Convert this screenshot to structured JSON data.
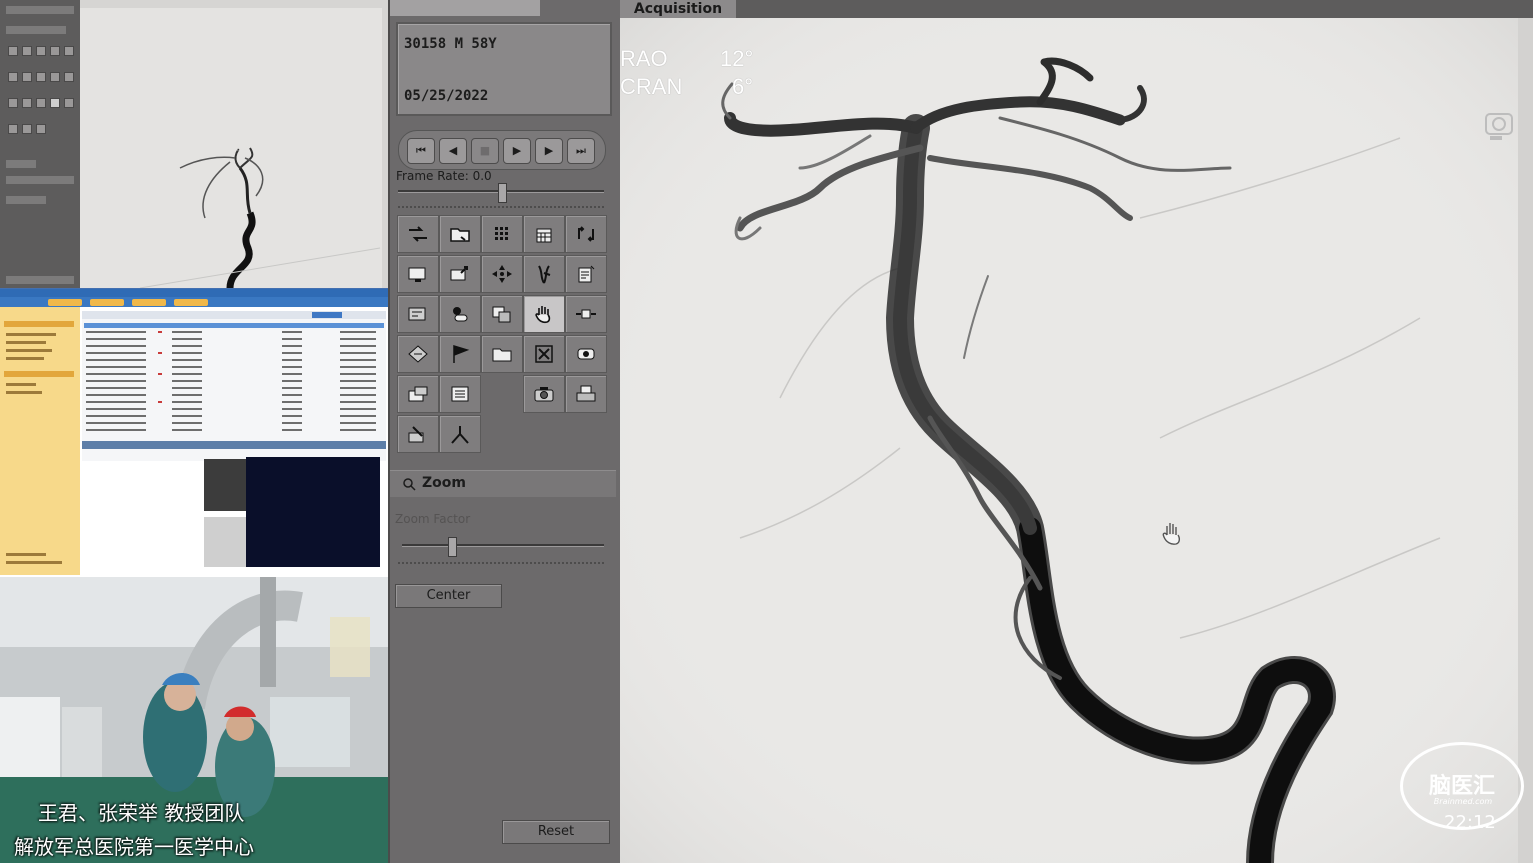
{
  "patient": {
    "id_line": "30158 M 58Y",
    "date": "05/25/2022"
  },
  "playback": {
    "frame_rate_label": "Frame Rate: 0.0",
    "buttons": [
      "first-frame",
      "step-back",
      "stop",
      "play",
      "step-forward",
      "last-frame"
    ]
  },
  "zoom": {
    "title": "Zoom",
    "factor_label": "Zoom Factor",
    "center_label": "Center",
    "reset_label": "Reset"
  },
  "viewer": {
    "tab_label": "Acquisition",
    "angle1_label": "RAO",
    "angle1_value": "12°",
    "angle2_label": "CRAN",
    "angle2_value": "6°"
  },
  "video": {
    "caption_line1": "王君、张荣举 教授团队",
    "caption_line2": "解放军总医院第一医学中心"
  },
  "watermark": {
    "logo_text": "脑医汇",
    "logo_sub": "Brainmed.com",
    "timestamp": "22:12"
  },
  "tools": [
    "loop-icon",
    "folder-icon",
    "grid-icon",
    "calendar-icon",
    "swap-icon",
    "monitor-icon",
    "export-icon",
    "move-icon",
    "vessel-icon",
    "note-icon",
    "measure-icon",
    "contrast-icon",
    "overlay-icon",
    "pan-hand-icon",
    "sync-icon",
    "rotate-icon",
    "flag-icon",
    "film-icon",
    "close-icon",
    "scan-icon",
    "report-icon",
    "list-icon",
    "camera-icon",
    "print-icon",
    "annotate-icon",
    "bifurcation-icon"
  ]
}
